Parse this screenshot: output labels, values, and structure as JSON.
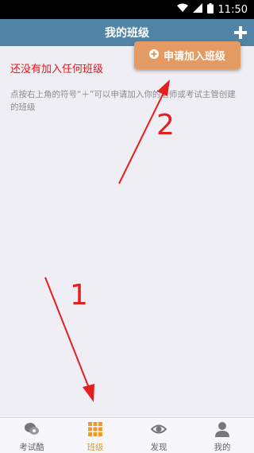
{
  "statusbar": {
    "time": "11:50"
  },
  "appbar": {
    "title": "我的班级"
  },
  "content": {
    "empty_title": "还没有加入任何班级",
    "hint": "点按右上角的符号“＋”可以申请加入你的老师或考试主管创建的班级"
  },
  "popup": {
    "label": "申请加入班级"
  },
  "tabs": [
    {
      "label": "考试酷",
      "icon": "chat-bubbles-icon"
    },
    {
      "label": "班级",
      "icon": "grid-icon",
      "active": true
    },
    {
      "label": "发现",
      "icon": "eye-icon"
    },
    {
      "label": "我的",
      "icon": "person-icon"
    }
  ],
  "annotations": {
    "step1": "1",
    "step2": "2"
  },
  "colors": {
    "appbar": "#4f84a7",
    "accent": "#ee9a24",
    "popup": "#e39b63",
    "alert_text": "#e11919",
    "annotation": "#e41f1f"
  }
}
